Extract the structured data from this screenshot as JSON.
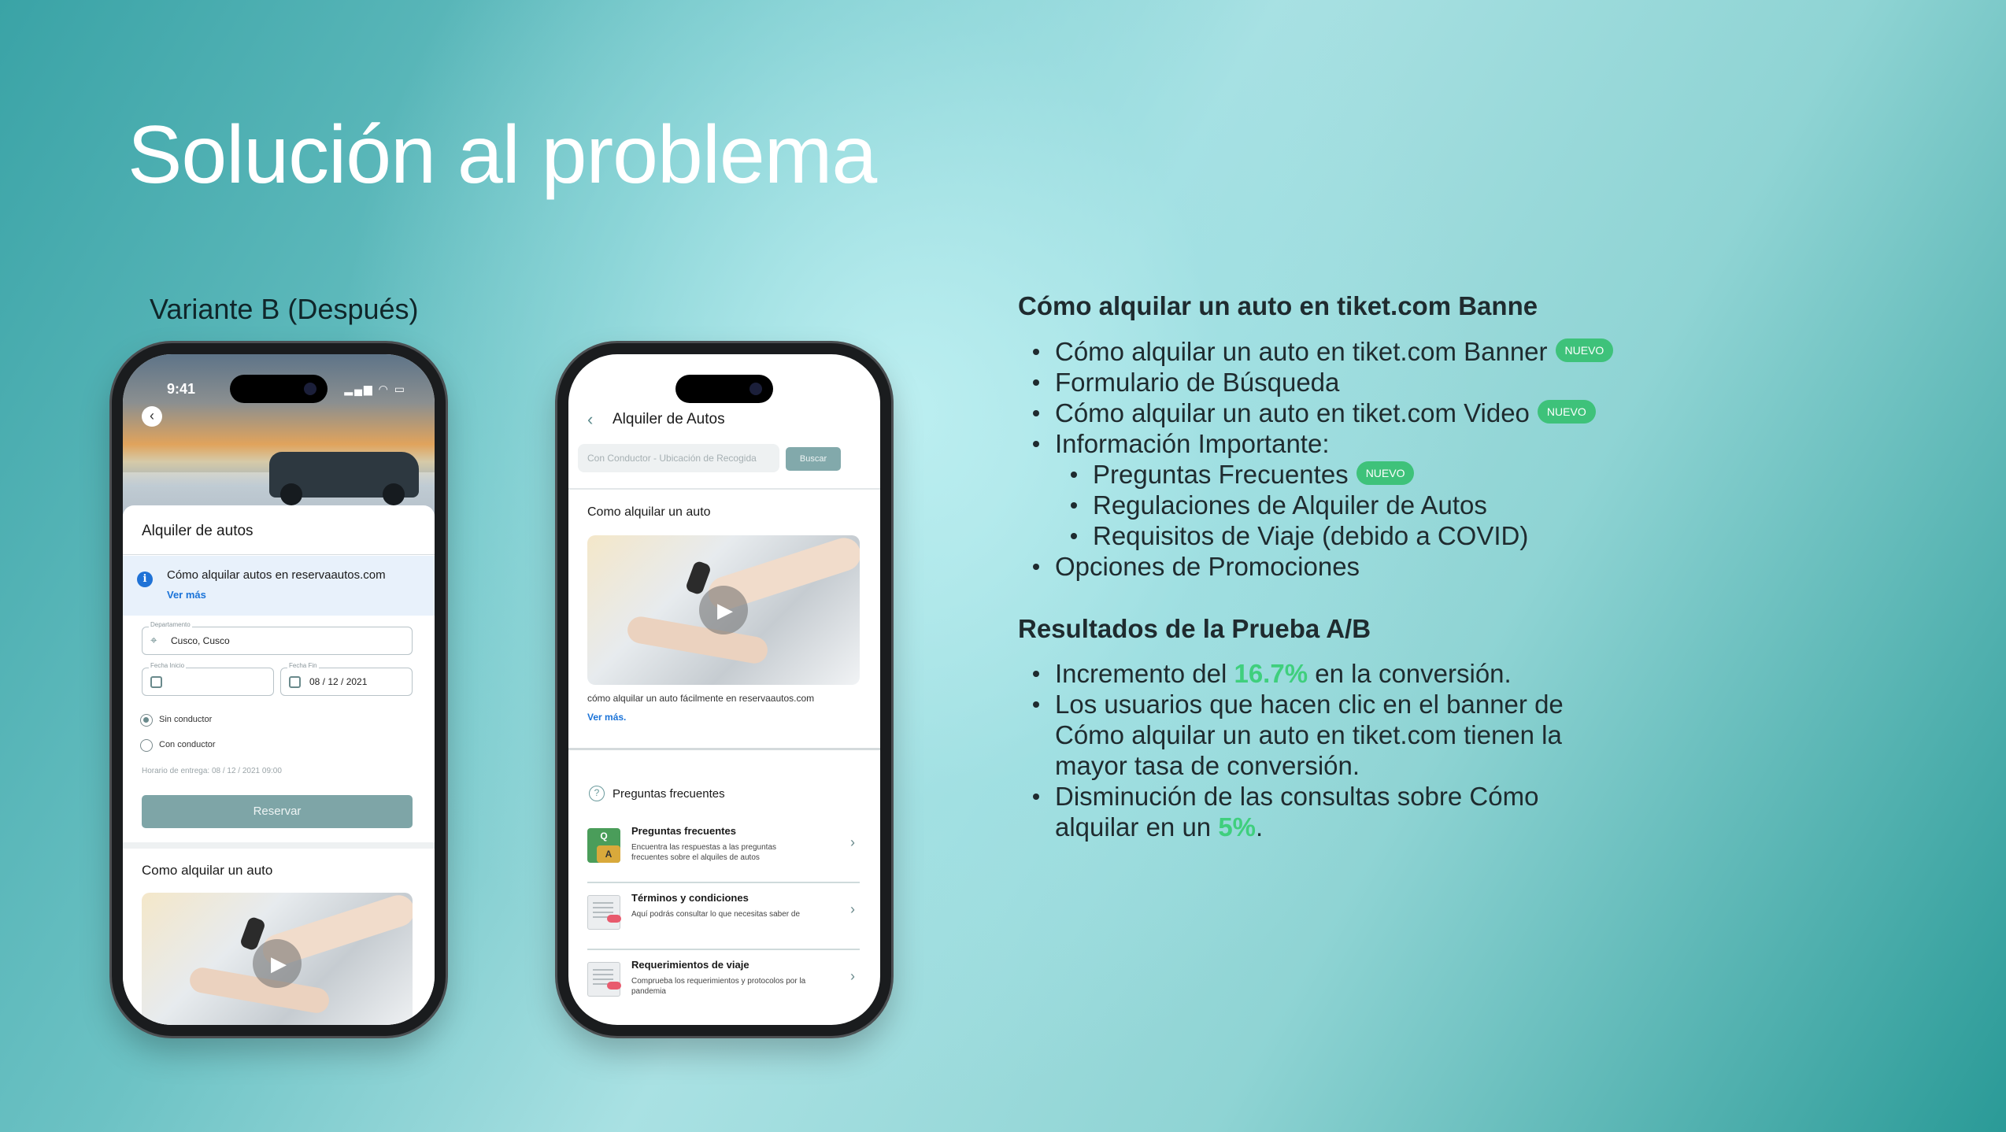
{
  "slide": {
    "title": "Solución al problema",
    "variant_label": "Variante B (Después)"
  },
  "phone1": {
    "status_time": "9:41",
    "status_icons": "▂▄▆ ◠ ▭",
    "sheet_title": "Alquiler de autos",
    "info_text": "Cómo alquilar autos en reservaautos.com",
    "info_link": "Ver más",
    "fields": {
      "destination_label": "Departamento",
      "destination_value": "Cusco, Cusco",
      "start_label": "Fecha Inicio",
      "start_value": "",
      "end_label": "Fecha Fin",
      "end_value": "08 / 12 / 2021"
    },
    "radio_without_driver": "Sin conductor",
    "radio_with_driver": "Con conductor",
    "delivery_hint": "Horario de entrega: 08 / 12 / 2021 09:00",
    "reserve_button": "Reservar",
    "how_to_title": "Como alquilar un auto"
  },
  "phone2": {
    "header_title": "Alquiler de Autos",
    "search_placeholder": "Con Conductor - Ubicación de Recogida",
    "search_button": "Buscar",
    "how_to_title": "Como alquilar un auto",
    "video_caption": "cómo alquilar un auto fácilmente en reservaautos.com",
    "video_link": "Ver más.",
    "faq_header": "Preguntas frecuentes",
    "rows": [
      {
        "title": "Preguntas frecuentes",
        "desc": "Encuentra las respuestas a las preguntas frecuentes sobre el alquiles de autos",
        "icon": "qa-icon"
      },
      {
        "title": "Términos y condiciones",
        "desc": "Aquí podrás consultar lo que necesitas saber de",
        "icon": "document-icon"
      },
      {
        "title": "Requerimientos de viaje",
        "desc": "Comprueba los requerimientos y protocolos por la pandemia",
        "icon": "document-icon"
      }
    ]
  },
  "right": {
    "section1_title": "Cómo alquilar un auto en tiket.com Banne",
    "badge": "NUEVO",
    "list1": [
      "Cómo alquilar un auto en tiket.com Banner",
      "Formulario de Búsqueda",
      "Cómo alquilar un auto en tiket.com Video",
      "Información Importante:",
      "Preguntas Frecuentes",
      "Regulaciones de Alquiler de Autos",
      "Requisitos de Viaje (debido a COVID)",
      "Opciones de Promociones"
    ],
    "section2_title": "Resultados de la Prueba A/B",
    "r1_pre": "Incremento del ",
    "r1_value": "16.7%",
    "r1_post": " en la conversión.",
    "r2": "Los usuarios que hacen clic en el banner de Cómo alquilar un auto en tiket.com tienen la mayor tasa de conversión.",
    "r3_pre": "Disminución de las consultas sobre Cómo alquilar en un ",
    "r3_value": "5%",
    "r3_post": "."
  },
  "colors": {
    "accent_green": "#3fcf7d",
    "badge_green": "#3ec27a",
    "button_teal": "#7ea5a7",
    "link_blue": "#1a73d8"
  }
}
